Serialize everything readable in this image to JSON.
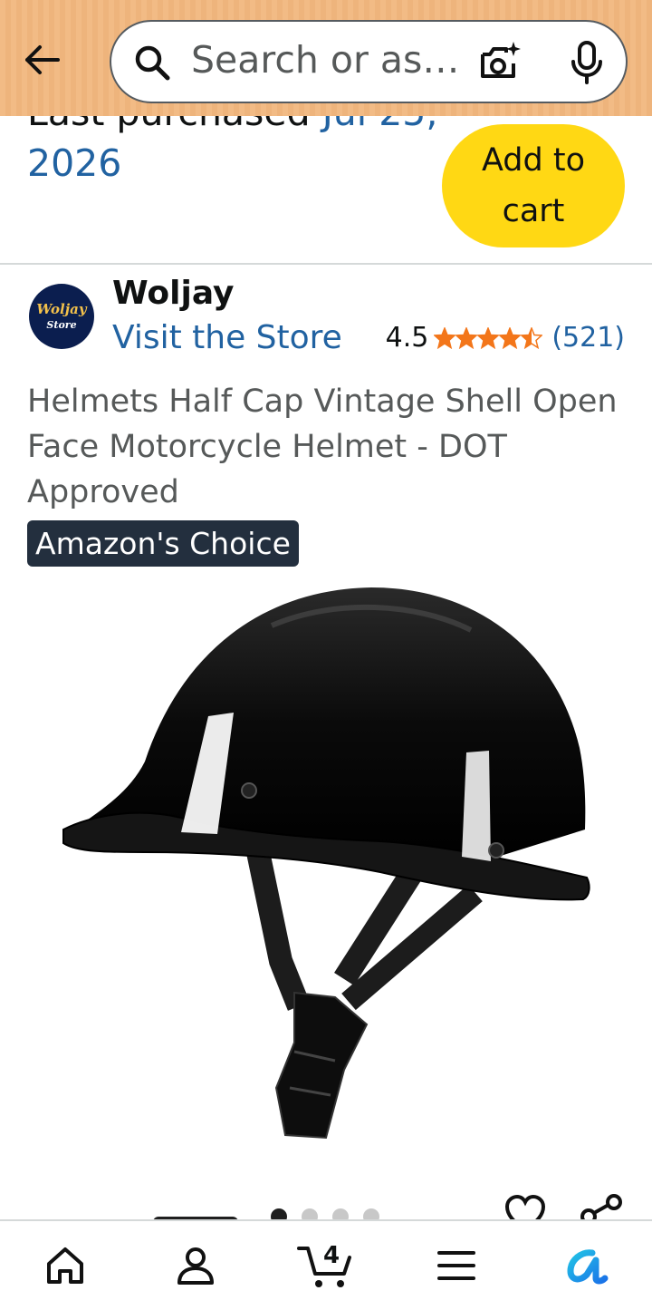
{
  "header": {
    "search_placeholder": "Search or as…"
  },
  "purchase": {
    "prefix": "Last purchased ",
    "date": "Jul 25, 2026",
    "add_to_cart_label": "Add to cart"
  },
  "brand": {
    "logo_line1": "Woljay",
    "logo_line2": "Store",
    "name": "Woljay",
    "visit_store": "Visit the Store"
  },
  "rating": {
    "value": "4.5",
    "stars": 4.5,
    "count": "(521)"
  },
  "product": {
    "title": "Helmets Half Cap Vintage Shell Open Face Motorcycle Helmet - DOT Approved",
    "badge": "Amazon's Choice"
  },
  "carousel": {
    "total": 4,
    "active": 1
  },
  "nav": {
    "cart_count": "4",
    "items": [
      "home-icon",
      "account-icon",
      "cart-icon",
      "menu-icon",
      "rufus-icon"
    ]
  },
  "colors": {
    "header_bg": "#f2bb85",
    "add_to_cart": "#ffd814",
    "link": "#2162a1",
    "star": "#f3761a",
    "badge_bg": "#232f3e"
  }
}
